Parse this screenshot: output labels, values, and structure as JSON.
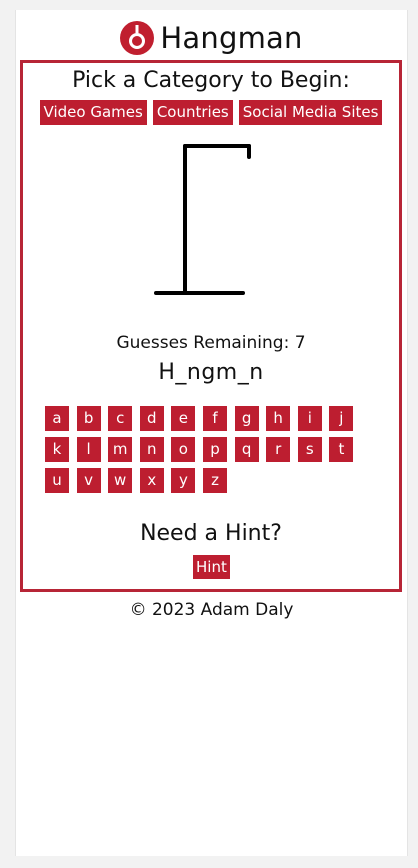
{
  "header": {
    "title": "Hangman",
    "logo_icon": "noose-icon",
    "accent_color": "#bd1e30"
  },
  "category": {
    "title": "Pick a Category to Begin:",
    "options": [
      "Video Games",
      "Countries",
      "Social Media Sites"
    ]
  },
  "game": {
    "guesses_label": "Guesses Remaining: 7",
    "word_display": "H_ngm_n",
    "letters": [
      "a",
      "b",
      "c",
      "d",
      "e",
      "f",
      "g",
      "h",
      "i",
      "j",
      "k",
      "l",
      "m",
      "n",
      "o",
      "p",
      "q",
      "r",
      "s",
      "t",
      "u",
      "v",
      "w",
      "x",
      "y",
      "z"
    ]
  },
  "hint": {
    "title": "Need a Hint?",
    "button_label": "Hint"
  },
  "footer": {
    "copyright": "© 2023 Adam Daly"
  }
}
